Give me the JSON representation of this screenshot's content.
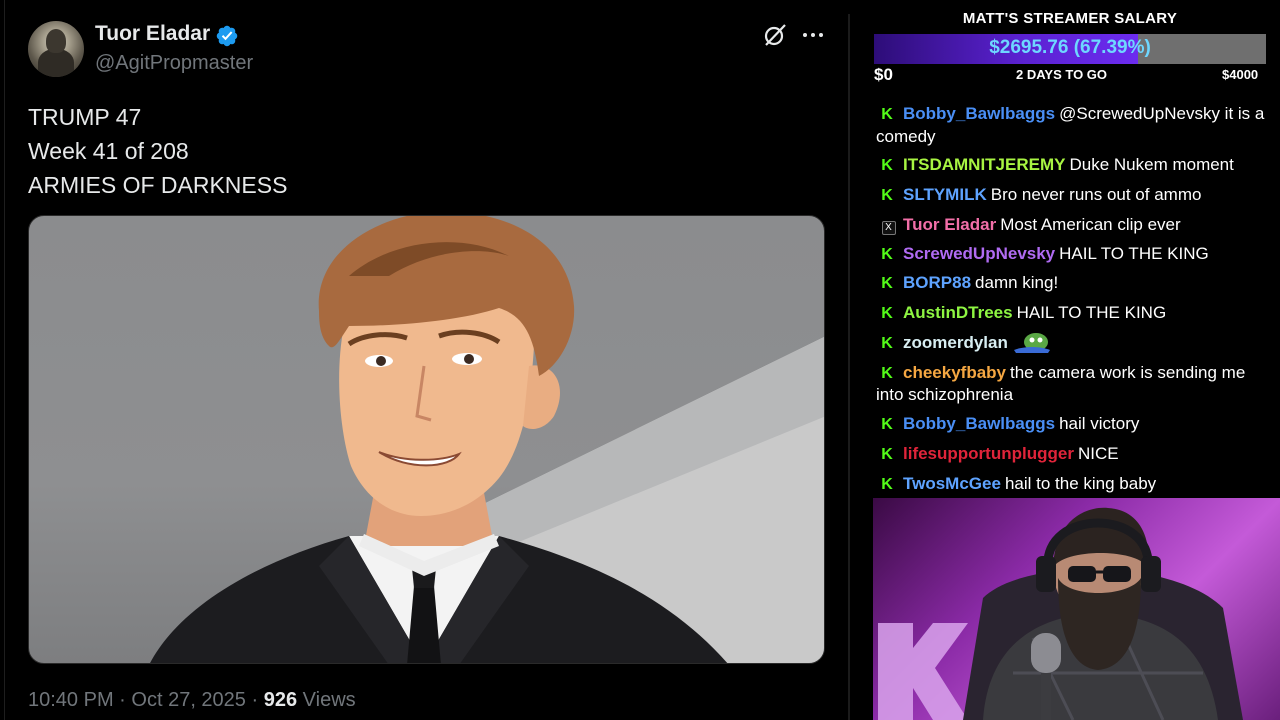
{
  "tweet": {
    "author_name": "Tuor Eladar",
    "handle": "@AgitPropmaster",
    "text_lines": [
      "TRUMP 47",
      "Week 41 of 208",
      "ARMIES OF DARKNESS"
    ],
    "time": "10:40 PM",
    "separator": "·",
    "date": "Oct 27, 2025",
    "views_count": "926",
    "views_label": "Views",
    "icons": [
      "verified-badge-icon",
      "grok-icon",
      "more-icon"
    ],
    "media": "illustration of a smiling man in a black suit and tie"
  },
  "salary": {
    "title": "MATT'S STREAMER SALARY",
    "amount": "$2695.76 (67.39%)",
    "progress": 0.6739,
    "min_label": "$0",
    "time_left": "2 DAYS TO GO",
    "max_label": "$4000"
  },
  "chat": {
    "messages": [
      {
        "user": "Bobby_Bawlbaggs",
        "color": "#4a8ff5",
        "badge": "kick",
        "text": "@ScrewedUpNevsky it is a comedy"
      },
      {
        "user": "ITSDAMNITJEREMY",
        "color": "#a8f542",
        "badge": "kick",
        "text": "Duke Nukem moment"
      },
      {
        "user": "SLTYMILK",
        "color": "#5ea3ff",
        "badge": "kick",
        "text": "Bro never runs out of ammo"
      },
      {
        "user": "Tuor Eladar",
        "color": "#f26fa8",
        "badge": "x",
        "text": "Most American clip ever"
      },
      {
        "user": "ScrewedUpNevsky",
        "color": "#b06bf2",
        "badge": "kick",
        "text": "HAIL TO THE KING"
      },
      {
        "user": "BORP88",
        "color": "#5ea3ff",
        "badge": "kick",
        "text": "damn king!"
      },
      {
        "user": "AustinDTrees",
        "color": "#8ef542",
        "badge": "kick",
        "text": "HAIL TO THE KING"
      },
      {
        "user": "zoomerdylan",
        "color": "#d8eef2",
        "badge": "kick",
        "text": "",
        "emote": "pepe-emote"
      },
      {
        "user": "cheekyfbaby",
        "color": "#f5a742",
        "badge": "kick",
        "text": "the camera work is sending me into schizophrenia"
      },
      {
        "user": "Bobby_Bawlbaggs",
        "color": "#4a8ff5",
        "badge": "kick",
        "text": "hail victory"
      },
      {
        "user": "lifesupportunplugger",
        "color": "#e0243a",
        "badge": "kick",
        "text": "NICE"
      },
      {
        "user": "TwosMcGee",
        "color": "#5ea3ff",
        "badge": "kick",
        "text": "hail to the king baby"
      }
    ]
  },
  "colors": {
    "kick_green": "#53fc18",
    "salary_fill": "#5a21d0",
    "salary_text": "#6ed7ff",
    "x_muted": "#71767b",
    "x_verified": "#1d9bf0"
  }
}
